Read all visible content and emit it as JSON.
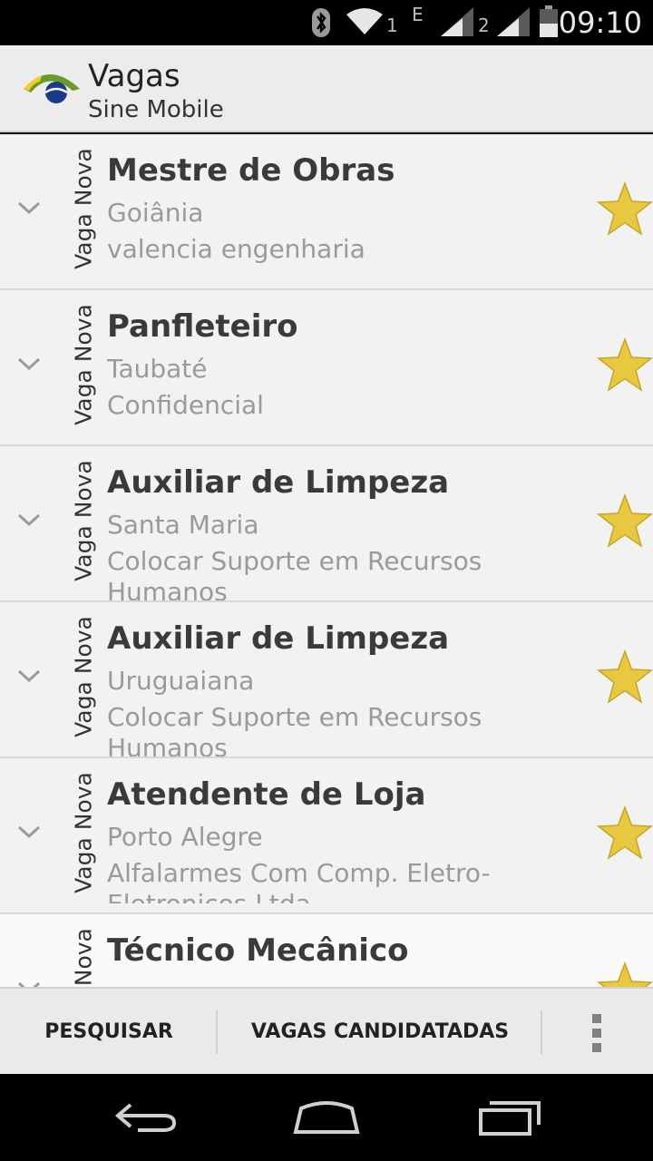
{
  "status_bar": {
    "time": "09:10",
    "sim1_label": "1",
    "network_type": "E",
    "sim2_label": "2",
    "icons": [
      "bluetooth-icon",
      "wifi-icon",
      "signal-icon",
      "signal-icon",
      "battery-icon"
    ]
  },
  "action_bar": {
    "title": "Vagas",
    "subtitle": "Sine Mobile"
  },
  "jobs": [
    {
      "badge": "Vaga Nova",
      "title": "Mestre de Obras",
      "city": "Goiânia",
      "company": "valencia engenharia"
    },
    {
      "badge": "Vaga Nova",
      "title": "Panfleteiro",
      "city": "Taubaté",
      "company": "Confidencial"
    },
    {
      "badge": "Vaga Nova",
      "title": "Auxiliar de Limpeza",
      "city": "Santa Maria",
      "company": "Colocar Suporte em Recursos Humanos"
    },
    {
      "badge": "Vaga Nova",
      "title": "Auxiliar de Limpeza",
      "city": "Uruguaiana",
      "company": "Colocar Suporte em Recursos Humanos"
    },
    {
      "badge": "Vaga Nova",
      "title": "Atendente de Loja",
      "city": "Porto Alegre",
      "company": "Alfalarmes Com Comp. Eletro-Eletronicos Ltda"
    },
    {
      "badge": "Vaga Nova",
      "title": "Técnico Mecânico",
      "city": "",
      "company": ""
    }
  ],
  "bottom_bar": {
    "search_label": "PESQUISAR",
    "applied_label": "VAGAS CANDIDATADAS"
  },
  "colors": {
    "star_gold": "#e8c840",
    "logo_green": "#6a9a2a",
    "logo_yellow": "#f0d020",
    "logo_blue": "#1a3a8a"
  }
}
